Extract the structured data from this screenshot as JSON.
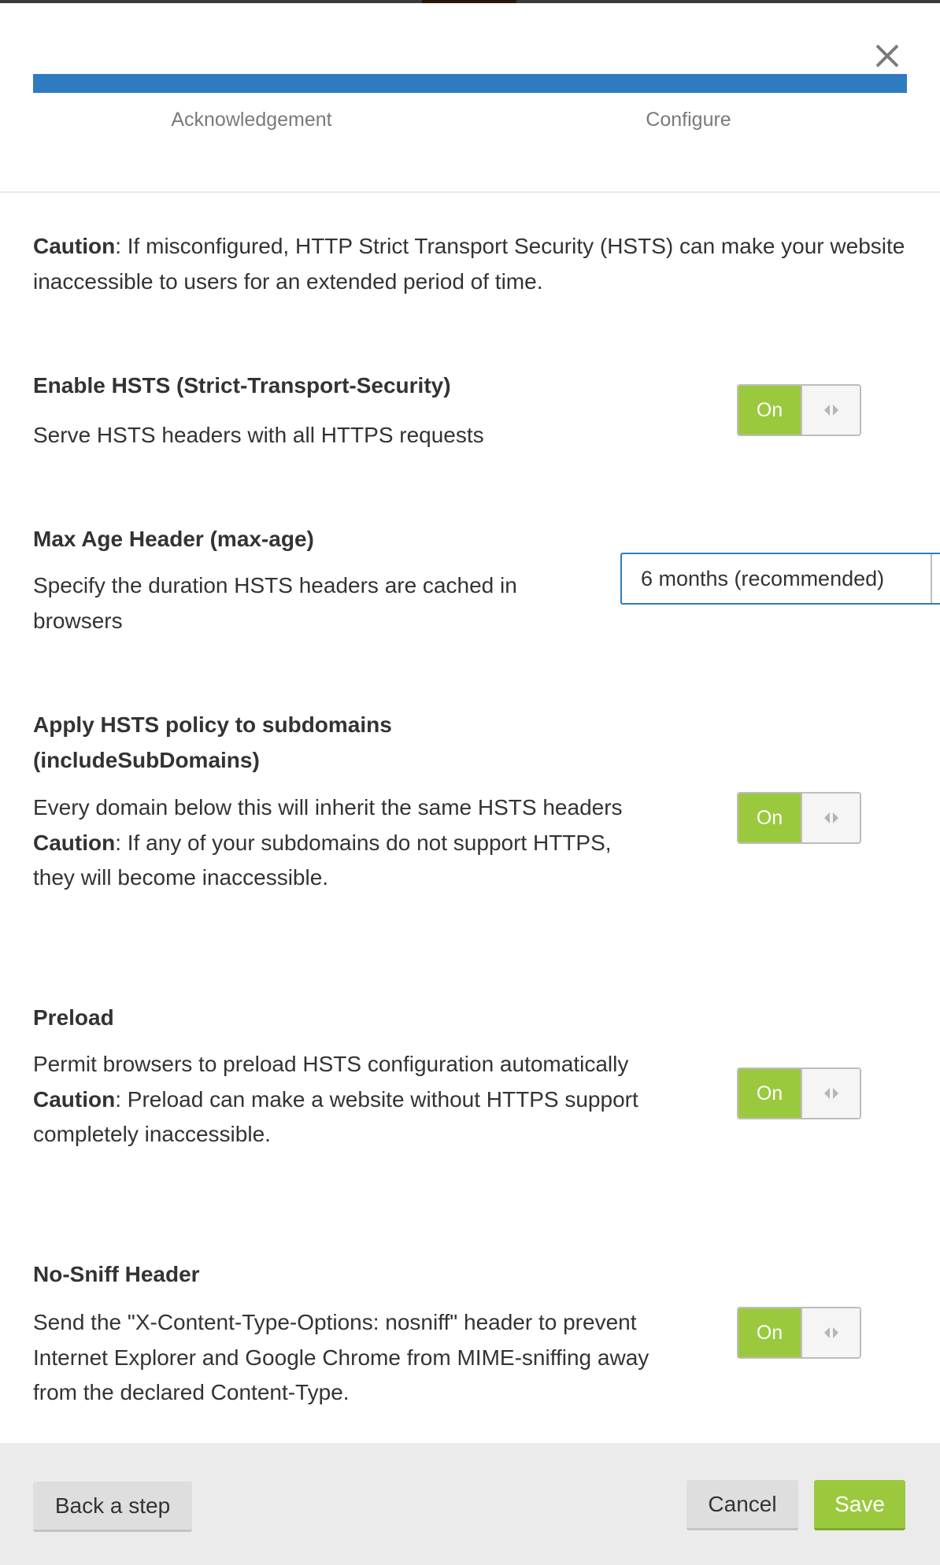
{
  "wizard": {
    "close_icon": "close-icon",
    "progress_fraction": 1.0,
    "progress_color": "#2f7bbf",
    "steps": [
      {
        "label": "Acknowledgement"
      },
      {
        "label": "Configure"
      }
    ]
  },
  "caution": {
    "label": "Caution",
    "text": ": If misconfigured, HTTP Strict Transport Security (HSTS) can make your website inaccessible to users for an extended period of time."
  },
  "settings": {
    "enable_hsts": {
      "title": "Enable HSTS (Strict-Transport-Security)",
      "description": "Serve HSTS headers with all HTTPS requests",
      "toggle": {
        "label": "On",
        "state": true
      }
    },
    "max_age": {
      "title": "Max Age Header (max-age)",
      "description": "Specify the duration HSTS headers are cached in browsers",
      "select": {
        "value": "6 months (recommended)"
      }
    },
    "subdomains": {
      "title": "Apply HSTS policy to subdomains (includeSubDomains)",
      "description": "Every domain below this will inherit the same HSTS headers",
      "caution_label": "Caution",
      "caution_text": ": If any of your subdomains do not support HTTPS, they will become inaccessible.",
      "toggle": {
        "label": "On",
        "state": true
      }
    },
    "preload": {
      "title": "Preload",
      "description": "Permit browsers to preload HSTS configuration automatically",
      "caution_label": "Caution",
      "caution_text": ": Preload can make a website without HTTPS support completely inaccessible.",
      "toggle": {
        "label": "On",
        "state": true
      }
    },
    "nosniff": {
      "title": "No-Sniff Header",
      "description": "Send the \"X-Content-Type-Options: nosniff\" header to prevent Internet Explorer and Google Chrome from MIME-sniffing away from the declared Content-Type.",
      "toggle": {
        "label": "On",
        "state": true
      }
    }
  },
  "footer": {
    "back_label": "Back a step",
    "cancel_label": "Cancel",
    "save_label": "Save"
  },
  "colors": {
    "accent_green": "#9bc93e",
    "accent_blue": "#2f7bbf"
  }
}
